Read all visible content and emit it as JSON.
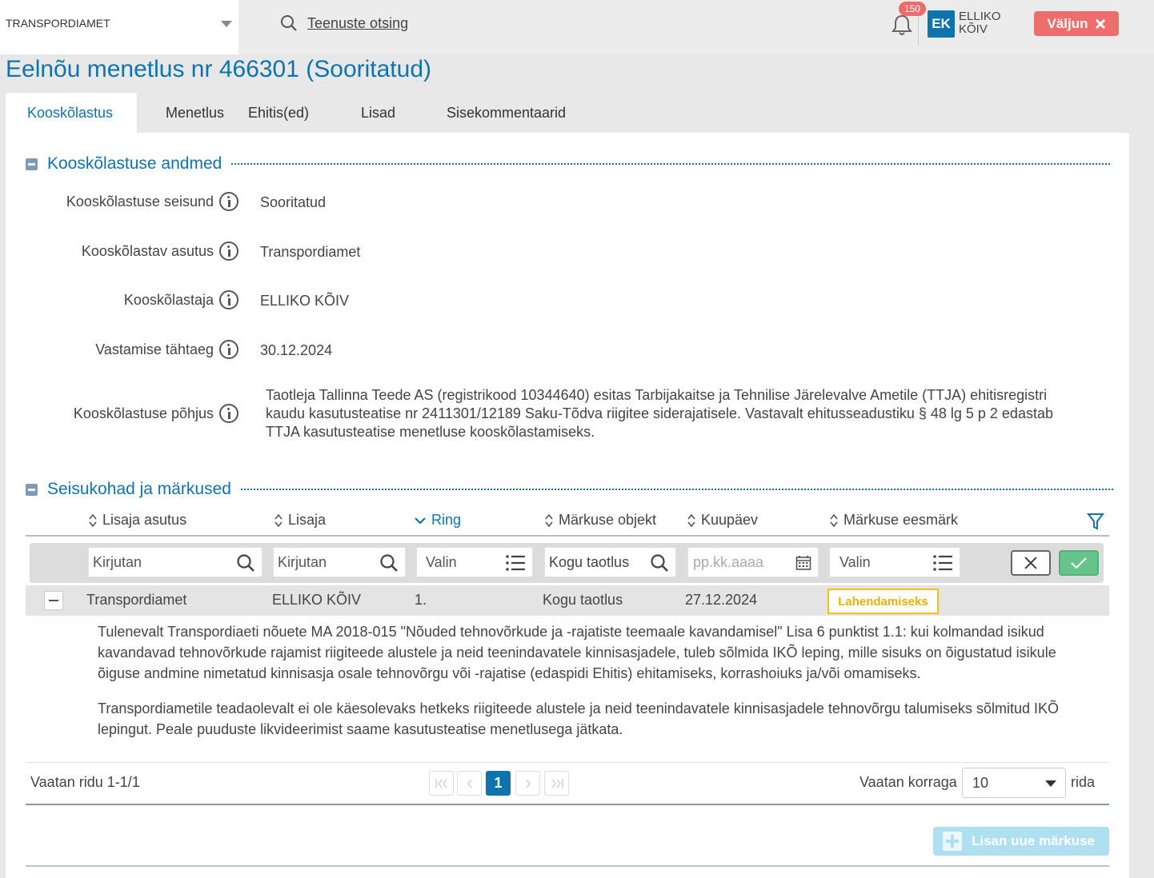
{
  "header": {
    "organization": "TRANSPORDIAMET",
    "search_link": "Teenuste otsing",
    "notification_count": "150",
    "user_initials": "EK",
    "user_name": "ELLIKO KÕIV",
    "logout_label": "Väljun"
  },
  "page_title": "Eelnõu menetlus nr 466301 (Sooritatud)",
  "tabs": [
    "Kooskõlastus",
    "Menetlus",
    "Ehitis(ed)",
    "Lisad",
    "Sisekommentaarid"
  ],
  "active_tab": "Kooskõlastus",
  "details_section": {
    "title": "Kooskõlastuse andmed",
    "fields": [
      {
        "label": "Kooskõlastuse seisund",
        "value": "Sooritatud"
      },
      {
        "label": "Kooskõlastav asutus",
        "value": "Transpordiamet"
      },
      {
        "label": "Kooskõlastaja",
        "value": "ELLIKO KÕIV"
      },
      {
        "label": "Vastamise tähtaeg",
        "value": "30.12.2024"
      },
      {
        "label": "Kooskõlastuse põhjus",
        "value": "Taotleja Tallinna Teede AS (registrikood 10344640) esitas Tarbijakaitse ja Tehnilise Järelevalve Ametile (TTJA) ehitisregistri kaudu kasutusteatise nr 2411301/12189 Saku-Tõdva riigitee siderajatisele. Vastavalt ehitusseadustiku § 48 lg 5 p 2 edastab TTJA kasutusteatise menetluse kooskõlastamiseks."
      }
    ]
  },
  "remarks_section": {
    "title": "Seisukohad ja märkused",
    "columns": [
      "Lisaja asutus",
      "Lisaja",
      "Ring",
      "Märkuse objekt",
      "Kuupäev",
      "Märkuse eesmärk"
    ],
    "sorted_column": "Ring",
    "filters": {
      "lisaja_asutus_placeholder": "Kirjutan",
      "lisaja_placeholder": "Kirjutan",
      "ring_placeholder": "Valin",
      "objekt_value": "Kogu taotlus",
      "kuupaev_placeholder": "pp.kk.aaaa",
      "eesmark_placeholder": "Valin"
    },
    "rows": [
      {
        "lisaja_asutus": "Transpordiamet",
        "lisaja": "ELLIKO KÕIV",
        "ring": "1.",
        "objekt": "Kogu taotlus",
        "kuupaev": "27.12.2024",
        "eesmark": "Lahendamiseks",
        "comment_paragraphs": [
          "Tulenevalt Transpordiaeti nõuete MA 2018-015 \"Nõuded tehnovõrkude ja -rajatiste teemaale kavandamisel\" Lisa 6 punktist 1.1: kui kolmandad isikud kavandavad tehnovõrkude rajamist riigiteede alustele ja neid teenindavatele kinnisasjadele, tuleb sõlmida IKÕ leping, mille sisuks on õigustatud isikule õiguse andmine nimetatud kinnisasja osale tehnovõrgu või -rajatise (edaspidi Ehitis) ehitamiseks, korrashoiuks ja/või omamiseks.",
          "Transpordiametile teadaolevalt ei ole käesolevaks hetkeks riigiteede alustele ja neid teenindavatele kinnisasjadele tehnovõrgu talumiseks sõlmitud IKÕ lepingut. Peale puuduste likvideerimist saame kasutusteatise menetlusega jätkata."
        ]
      }
    ],
    "pagination": {
      "info": "Vaatan ridu 1-1/1",
      "current_page": "1",
      "per_page_label": "Vaatan korraga",
      "per_page_value": "10",
      "per_page_suffix": "rida"
    },
    "add_button": "Lisan uue märkuse"
  },
  "colors": {
    "accent": "#0f73ad",
    "logout": "#ee6e6e",
    "badge_border": "#f4c01a",
    "confirm": "#66c48a"
  }
}
